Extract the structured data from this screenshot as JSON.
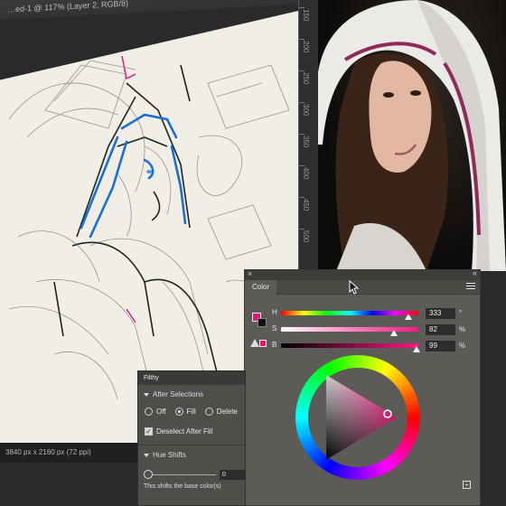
{
  "document": {
    "tab_title": "…ed-1 @ 117% (Layer 2, RGB/8)",
    "ruler_ticks": [
      "150",
      "200",
      "250",
      "300",
      "350",
      "400",
      "450",
      "500"
    ],
    "status": "3840 px x 2160 px (72 ppi)"
  },
  "color_panel": {
    "tab_label": "Color",
    "channels": [
      {
        "label": "H",
        "value": "333",
        "unit": "°",
        "level": 0.925
      },
      {
        "label": "S",
        "value": "82",
        "unit": "%",
        "level": 0.82
      },
      {
        "label": "B",
        "value": "99",
        "unit": "%",
        "level": 0.99
      }
    ],
    "foreground_color": "#e0157a",
    "background_color": "#111111",
    "icons": [
      "warning-icon",
      "menu-icon",
      "close-icon",
      "collapse-icon",
      "new-swatch-icon"
    ]
  },
  "filthy_panel": {
    "title": "Filthy",
    "after_selections": {
      "heading": "After Selections",
      "options": [
        "Off",
        "Fill",
        "Delete"
      ],
      "selected": "Fill"
    },
    "deselect_after_fill": {
      "label": "Deselect After Fill",
      "checked": true
    },
    "hue_shifts": {
      "heading": "Hue Shifts",
      "value": "0",
      "description": "This shifts the base color(s)"
    }
  },
  "colors": {
    "accent_magenta": "#e0157a",
    "panel_bg": "#5d5b57",
    "ink_blue": "#1a6fd6"
  }
}
